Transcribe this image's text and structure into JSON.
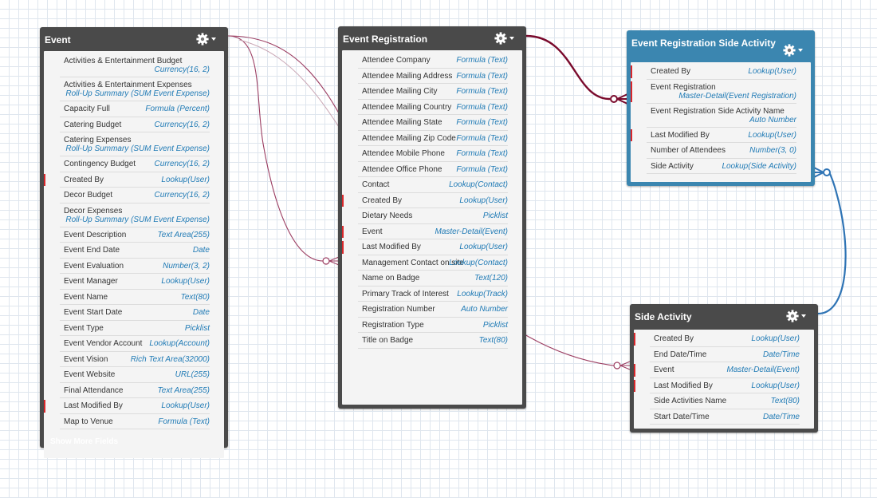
{
  "colors": {
    "object_header": "#4a4a4a",
    "selected_header": "#3b86b0",
    "field_type": "#1f7ab5",
    "required_marker": "#d9262a",
    "connector_maroon": "#7a0a2c",
    "connector_blue": "#2f74b5",
    "connector_light": "#9c3e62"
  },
  "objects": {
    "event": {
      "title": "Event",
      "gear_icon": "gear-icon",
      "footer_link": "Show More Fields",
      "fields": [
        {
          "name": "Activities & Entertainment Budget",
          "type": "Currency(16, 2)",
          "required": false
        },
        {
          "name": "Activities & Entertainment Expenses",
          "type": "Roll-Up Summary (SUM Event Expense)",
          "required": false
        },
        {
          "name": "Capacity Full",
          "type": "Formula (Percent)",
          "required": false
        },
        {
          "name": "Catering Budget",
          "type": "Currency(16, 2)",
          "required": false
        },
        {
          "name": "Catering Expenses",
          "type": "Roll-Up Summary (SUM Event Expense)",
          "required": false
        },
        {
          "name": "Contingency Budget",
          "type": "Currency(16, 2)",
          "required": false
        },
        {
          "name": "Created By",
          "type": "Lookup(User)",
          "required": true
        },
        {
          "name": "Decor Budget",
          "type": "Currency(16, 2)",
          "required": false
        },
        {
          "name": "Decor Expenses",
          "type": "Roll-Up Summary (SUM Event Expense)",
          "required": false
        },
        {
          "name": "Event Description",
          "type": "Text Area(255)",
          "required": false
        },
        {
          "name": "Event End Date",
          "type": "Date",
          "required": false
        },
        {
          "name": "Event Evaluation",
          "type": "Number(3, 2)",
          "required": false
        },
        {
          "name": "Event Manager",
          "type": "Lookup(User)",
          "required": false
        },
        {
          "name": "Event Name",
          "type": "Text(80)",
          "required": false
        },
        {
          "name": "Event Start Date",
          "type": "Date",
          "required": false
        },
        {
          "name": "Event Type",
          "type": "Picklist",
          "required": false
        },
        {
          "name": "Event Vendor Account",
          "type": "Lookup(Account)",
          "required": false
        },
        {
          "name": "Event Vision",
          "type": "Rich Text Area(32000)",
          "required": false
        },
        {
          "name": "Event Website",
          "type": "URL(255)",
          "required": false
        },
        {
          "name": "Final Attendance",
          "type": "Text Area(255)",
          "required": false
        },
        {
          "name": "Last Modified By",
          "type": "Lookup(User)",
          "required": true
        },
        {
          "name": "Map to Venue",
          "type": "Formula (Text)",
          "required": false
        }
      ]
    },
    "event_registration": {
      "title": "Event Registration",
      "gear_icon": "gear-icon",
      "fields": [
        {
          "name": "Attendee Company",
          "type": "Formula (Text)",
          "required": false
        },
        {
          "name": "Attendee Mailing Address",
          "type": "Formula (Text)",
          "required": false
        },
        {
          "name": "Attendee Mailing City",
          "type": "Formula (Text)",
          "required": false
        },
        {
          "name": "Attendee Mailing Country",
          "type": "Formula (Text)",
          "required": false
        },
        {
          "name": "Attendee Mailing State",
          "type": "Formula (Text)",
          "required": false
        },
        {
          "name": "Attendee Mailing Zip Code",
          "type": "Formula (Text)",
          "required": false
        },
        {
          "name": "Attendee Mobile Phone",
          "type": "Formula (Text)",
          "required": false
        },
        {
          "name": "Attendee Office Phone",
          "type": "Formula (Text)",
          "required": false
        },
        {
          "name": "Contact",
          "type": "Lookup(Contact)",
          "required": false
        },
        {
          "name": "Created By",
          "type": "Lookup(User)",
          "required": true
        },
        {
          "name": "Dietary Needs",
          "type": "Picklist",
          "required": false
        },
        {
          "name": "Event",
          "type": "Master-Detail(Event)",
          "required": true
        },
        {
          "name": "Last Modified By",
          "type": "Lookup(User)",
          "required": true
        },
        {
          "name": "Management Contact on site",
          "type": "Lookup(Contact)",
          "required": false
        },
        {
          "name": "Name on Badge",
          "type": "Text(120)",
          "required": false
        },
        {
          "name": "Primary Track of Interest",
          "type": "Lookup(Track)",
          "required": false
        },
        {
          "name": "Registration Number",
          "type": "Auto Number",
          "required": false
        },
        {
          "name": "Registration Type",
          "type": "Picklist",
          "required": false
        },
        {
          "name": "Title on Badge",
          "type": "Text(80)",
          "required": false
        }
      ]
    },
    "event_registration_side_activity": {
      "title": "Event Registration Side Activity",
      "gear_icon": "gear-icon",
      "fields": [
        {
          "name": "Created By",
          "type": "Lookup(User)",
          "required": true
        },
        {
          "name": "Event Registration",
          "type": "Master-Detail(Event Registration)",
          "required": true
        },
        {
          "name": "Event Registration Side Activity Name",
          "type": "Auto Number",
          "required": false
        },
        {
          "name": "Last Modified By",
          "type": "Lookup(User)",
          "required": true
        },
        {
          "name": "Number of Attendees",
          "type": "Number(3, 0)",
          "required": false
        },
        {
          "name": "Side Activity",
          "type": "Lookup(Side Activity)",
          "required": false
        }
      ]
    },
    "side_activity": {
      "title": "Side Activity",
      "gear_icon": "gear-icon",
      "fields": [
        {
          "name": "Created By",
          "type": "Lookup(User)",
          "required": true
        },
        {
          "name": "End Date/Time",
          "type": "Date/Time",
          "required": false
        },
        {
          "name": "Event",
          "type": "Master-Detail(Event)",
          "required": true
        },
        {
          "name": "Last Modified By",
          "type": "Lookup(User)",
          "required": true
        },
        {
          "name": "Side Activities Name",
          "type": "Text(80)",
          "required": false
        },
        {
          "name": "Start Date/Time",
          "type": "Date/Time",
          "required": false
        }
      ]
    }
  }
}
